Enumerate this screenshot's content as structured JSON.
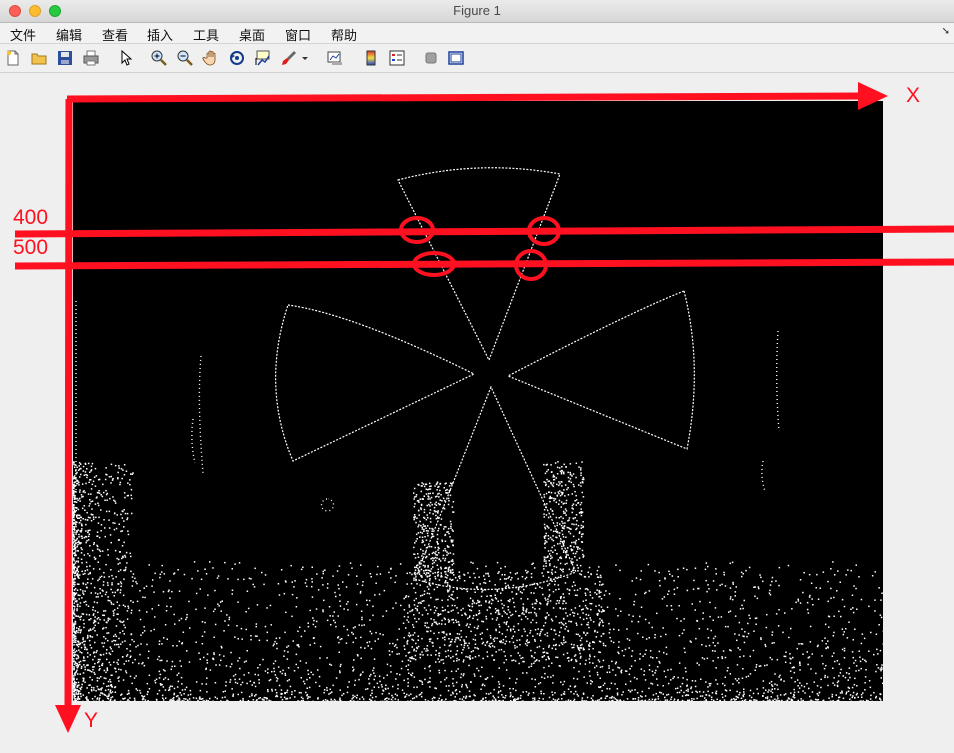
{
  "window": {
    "title": "Figure 1"
  },
  "menu": {
    "items": [
      "文件",
      "编辑",
      "查看",
      "插入",
      "工具",
      "桌面",
      "窗口",
      "帮助"
    ]
  },
  "toolbar": {
    "icons": [
      "new-figure-icon",
      "open-file-icon",
      "save-icon",
      "print-icon",
      "pointer-icon",
      "zoom-in-icon",
      "zoom-out-icon",
      "pan-hand-icon",
      "rotate-3d-icon",
      "data-cursor-icon",
      "brush-icon",
      "brush-dropdown-icon",
      "link-plot-icon",
      "colorbar-icon",
      "legend-icon",
      "hide-tools-icon",
      "plot-tools-icon"
    ]
  },
  "annotations": {
    "x_axis_label": "X",
    "y_axis_label": "Y",
    "row_label_1": "400",
    "row_label_2": "500",
    "color": "#ff1020"
  }
}
